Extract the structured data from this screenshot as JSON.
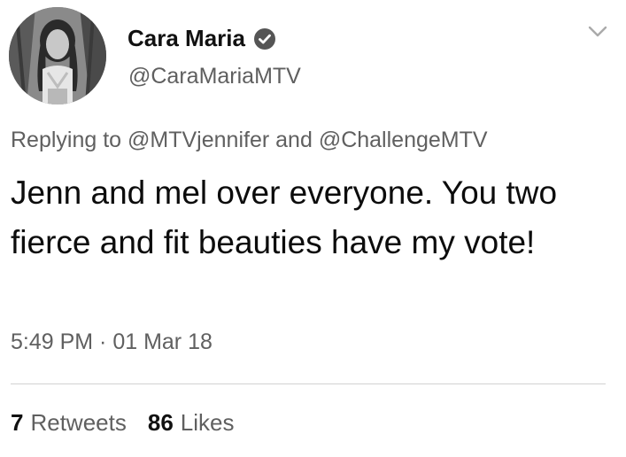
{
  "author": {
    "name": "Cara Maria",
    "handle": "@CaraMariaMTV",
    "verified": true
  },
  "reply": {
    "prefix": "Replying to",
    "mention1": "@MTVjennifer",
    "conjunction": "and",
    "mention2": "@ChallengeMTV"
  },
  "tweet": {
    "text": "Jenn and mel over everyone. You two fierce and fit beauties have my vote!"
  },
  "timestamp": "5:49 PM · 01 Mar 18",
  "stats": {
    "retweets_count": "7",
    "retweets_label": "Retweets",
    "likes_count": "86",
    "likes_label": "Likes"
  },
  "icons": {
    "verified": "verified-badge-icon",
    "menu": "chevron-down-icon"
  },
  "colors": {
    "text": "#111111",
    "secondary_text": "#606060",
    "divider": "#d2d2d2",
    "background": "#ffffff"
  }
}
